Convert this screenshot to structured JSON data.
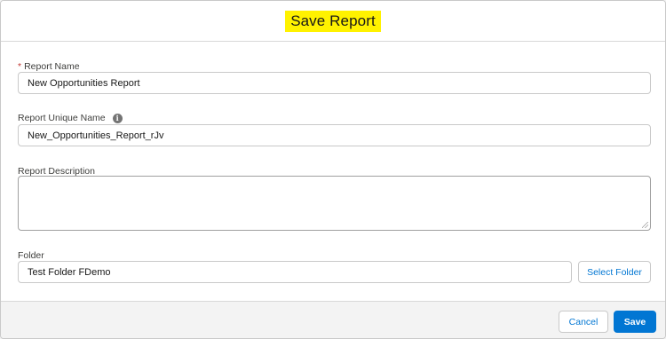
{
  "dialog": {
    "title": "Save Report"
  },
  "report_name": {
    "required_marker": "*",
    "label": "Report Name",
    "value": "New Opportunities Report"
  },
  "report_unique_name": {
    "label": "Report Unique Name",
    "info_icon": "info-icon",
    "info_glyph": "i",
    "value": "New_Opportunities_Report_rJv"
  },
  "report_description": {
    "label": "Report Description",
    "value": ""
  },
  "folder": {
    "label": "Folder",
    "value": "Test Folder FDemo",
    "select_button_label": "Select Folder"
  },
  "footer": {
    "cancel_label": "Cancel",
    "save_label": "Save"
  },
  "colors": {
    "brand": "#0176d3",
    "title_highlight": "#fff200",
    "required": "#c23934"
  }
}
